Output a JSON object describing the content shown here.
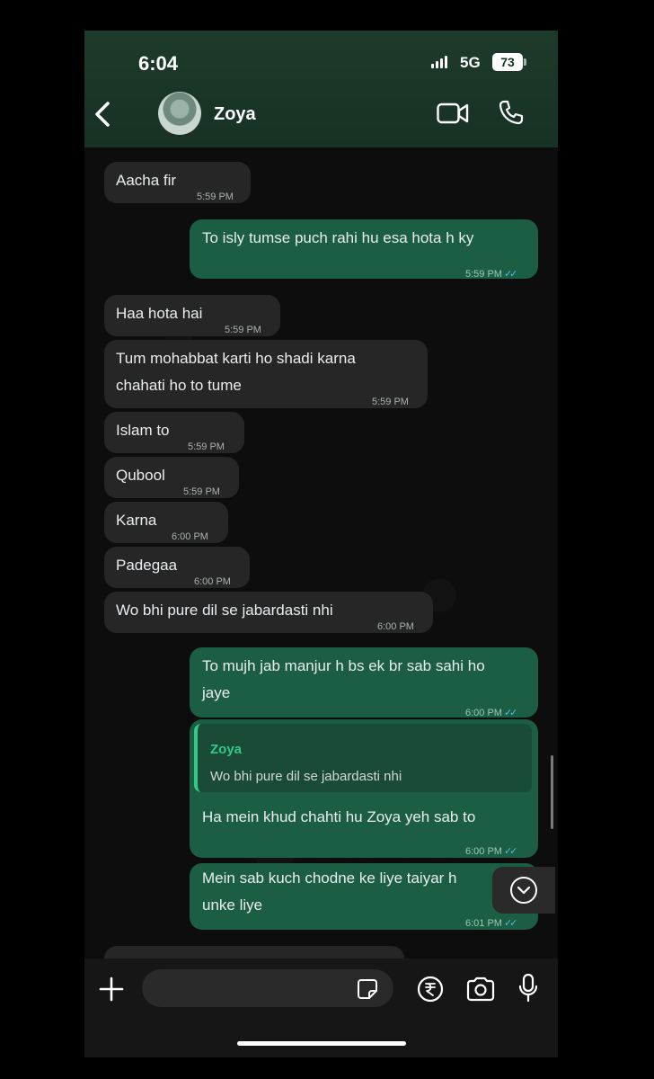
{
  "status_bar": {
    "time": "6:04",
    "network": "5G",
    "battery": "73"
  },
  "header": {
    "contact_name": "Zoya"
  },
  "icons": {
    "back": "chevron-left-icon",
    "video": "video-camera-icon",
    "call": "phone-icon",
    "attach": "plus-icon",
    "sticker": "sticker-icon",
    "payment": "rupee-icon",
    "camera": "camera-icon",
    "mic": "microphone-icon",
    "scroll": "chevron-down-icon"
  },
  "colors": {
    "header": "#173224",
    "incoming": "#262626",
    "outgoing": "#1b5e44",
    "read_ticks": "#53bdeb",
    "quote_accent": "#34c98b"
  },
  "messages": [
    {
      "direction": "in",
      "text": "Aacha fir",
      "time": "5:59 PM"
    },
    {
      "direction": "out",
      "text": "To isly tumse puch rahi hu esa hota h ky",
      "time": "5:59 PM",
      "status": "read"
    },
    {
      "direction": "in",
      "text": "Haa hota hai",
      "time": "5:59 PM"
    },
    {
      "direction": "in",
      "lines": [
        "Tum mohabbat karti ho shadi karna",
        "chahati ho to  tume"
      ],
      "time": "5:59 PM"
    },
    {
      "direction": "in",
      "text": "Islam to",
      "time": "5:59 PM"
    },
    {
      "direction": "in",
      "text": "Qubool",
      "time": "5:59 PM"
    },
    {
      "direction": "in",
      "text": "Karna",
      "time": "6:00 PM"
    },
    {
      "direction": "in",
      "text": "Padegaa",
      "time": "6:00 PM"
    },
    {
      "direction": "in",
      "text": "Wo bhi pure dil se jabardasti nhi",
      "time": "6:00 PM"
    },
    {
      "direction": "out",
      "lines": [
        "To mujh jab manjur h bs ek br sab sahi ho",
        "jaye"
      ],
      "time": "6:00 PM",
      "status": "read"
    },
    {
      "direction": "out",
      "reply_to": {
        "name": "Zoya",
        "text": "Wo bhi pure dil se jabardasti nhi"
      },
      "text": "Ha mein khud chahti hu Zoya yeh sab to",
      "time": "6:00 PM",
      "status": "read"
    },
    {
      "direction": "out",
      "lines": [
        "Mein sab kuch chodne ke liye taiyar h",
        "unke liye"
      ],
      "time": "6:01 PM",
      "status": "read"
    }
  ],
  "composer": {
    "placeholder": ""
  }
}
